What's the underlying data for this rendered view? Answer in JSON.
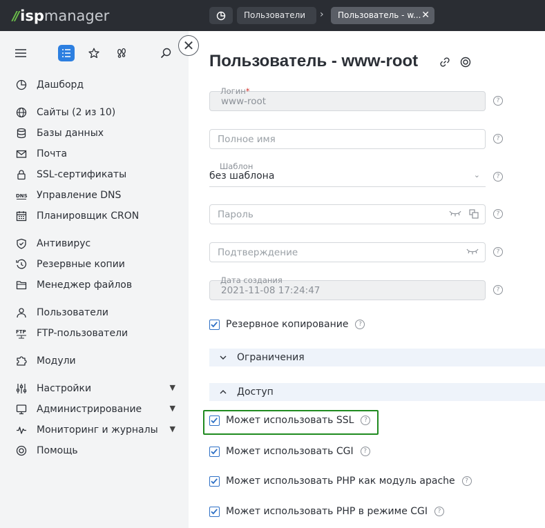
{
  "app": {
    "logo_isp": "isp",
    "logo_manager": "manager"
  },
  "breadcrumbs": {
    "users": "Пользователи",
    "current": "Пользователь - w..."
  },
  "sidebar": {
    "items": [
      {
        "label": "Дашборд",
        "icon": "dashboard-icon"
      },
      {
        "label": "Сайты (2 из 10)",
        "icon": "globe-icon"
      },
      {
        "label": "Базы данных",
        "icon": "database-icon"
      },
      {
        "label": "Почта",
        "icon": "mail-icon"
      },
      {
        "label": "SSL-сертификаты",
        "icon": "lock-icon"
      },
      {
        "label": "Управление DNS",
        "icon": "dns-icon"
      },
      {
        "label": "Планировщик CRON",
        "icon": "calendar-icon"
      },
      {
        "label": "Антивирус",
        "icon": "shield-icon"
      },
      {
        "label": "Резервные копии",
        "icon": "backup-icon"
      },
      {
        "label": "Менеджер файлов",
        "icon": "folder-icon"
      },
      {
        "label": "Пользователи",
        "icon": "user-icon"
      },
      {
        "label": "FTP-пользователи",
        "icon": "ftp-icon"
      },
      {
        "label": "Модули",
        "icon": "puzzle-icon"
      },
      {
        "label": "Настройки",
        "icon": "sliders-icon"
      },
      {
        "label": "Администрирование",
        "icon": "monitor-icon"
      },
      {
        "label": "Мониторинг и журналы",
        "icon": "pulse-icon"
      },
      {
        "label": "Помощь",
        "icon": "lifebuoy-icon"
      }
    ]
  },
  "main": {
    "title": "Пользователь - www-root",
    "fields": {
      "login_label": "Логин",
      "login_required": "*",
      "login_value": "www-root",
      "fullname_placeholder": "Полное имя",
      "template_label": "Шаблон",
      "template_value": "без шаблона",
      "password_placeholder": "Пароль",
      "confirm_placeholder": "Подтверждение",
      "created_label": "Дата создания",
      "created_value": "2021-11-08 17:24:47"
    },
    "backup_label": "Резервное копирование",
    "section_limits": "Ограничения",
    "section_access": "Доступ",
    "access": {
      "ssl": "Может использовать SSL",
      "cgi": "Может использовать CGI",
      "php_apache": "Может использовать PHP как модуль apache",
      "php_cgi": "Может использовать PHP в режиме CGI"
    },
    "help_glyph": "?"
  },
  "colors": {
    "accent": "#2d7fe0",
    "highlight": "#1f8a1f",
    "topbar": "#2a2d33"
  }
}
